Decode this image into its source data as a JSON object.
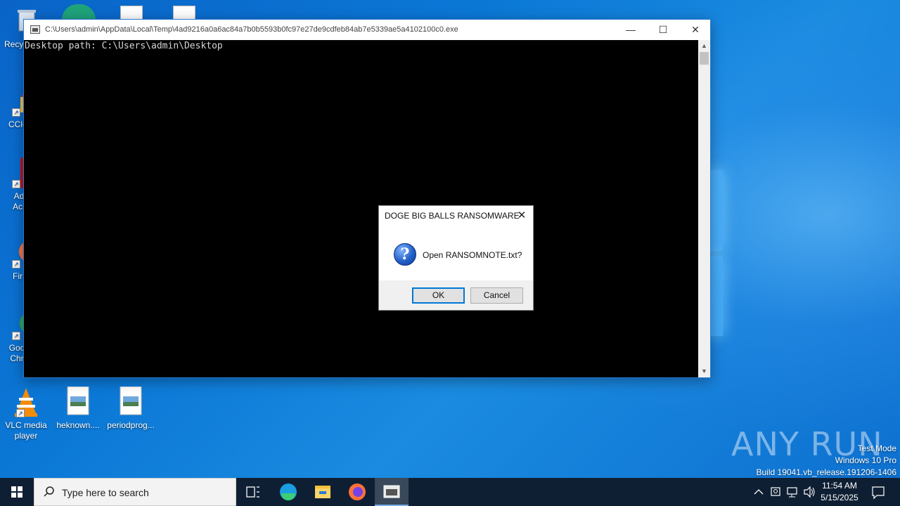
{
  "desktop": {
    "icons": [
      {
        "label": "Recy",
        "kind": "recycle-bin"
      },
      {
        "label": "CCle",
        "kind": "ccleaner"
      },
      {
        "label": "Ad Acr",
        "kind": "adobe-acrobat"
      },
      {
        "label": "Fir",
        "kind": "firefox"
      },
      {
        "label": "Goo Chr",
        "kind": "chrome"
      },
      {
        "label": "VLC media player",
        "kind": "vlc"
      },
      {
        "label": "heknown....",
        "kind": "image-file"
      },
      {
        "label": "periodprog...",
        "kind": "image-file"
      }
    ]
  },
  "console": {
    "title": "C:\\Users\\admin\\AppData\\Local\\Temp\\4ad9216a0a6ac84a7b0b5593b0fc97e27de9cdfeb84ab7e5339ae5a4102100c0.exe",
    "output": "Desktop path: C:\\Users\\admin\\Desktop"
  },
  "dialog": {
    "title": "DOGE BIG BALLS RANSOMWARE",
    "message": "Open RANSOMNOTE.txt?",
    "ok_label": "OK",
    "cancel_label": "Cancel"
  },
  "watermark": {
    "brand": "ANY RUN"
  },
  "system": {
    "test_mode": "Test Mode",
    "edition": "Windows 10 Pro",
    "build": "Build 19041.vb_release.191206-1406"
  },
  "taskbar": {
    "search_placeholder": "Type here to search",
    "time": "11:54 AM",
    "date": "5/15/2025"
  },
  "colors": {
    "accent": "#0078d7",
    "taskbar": "#0f1f33",
    "desktop": "#0b78d6"
  }
}
